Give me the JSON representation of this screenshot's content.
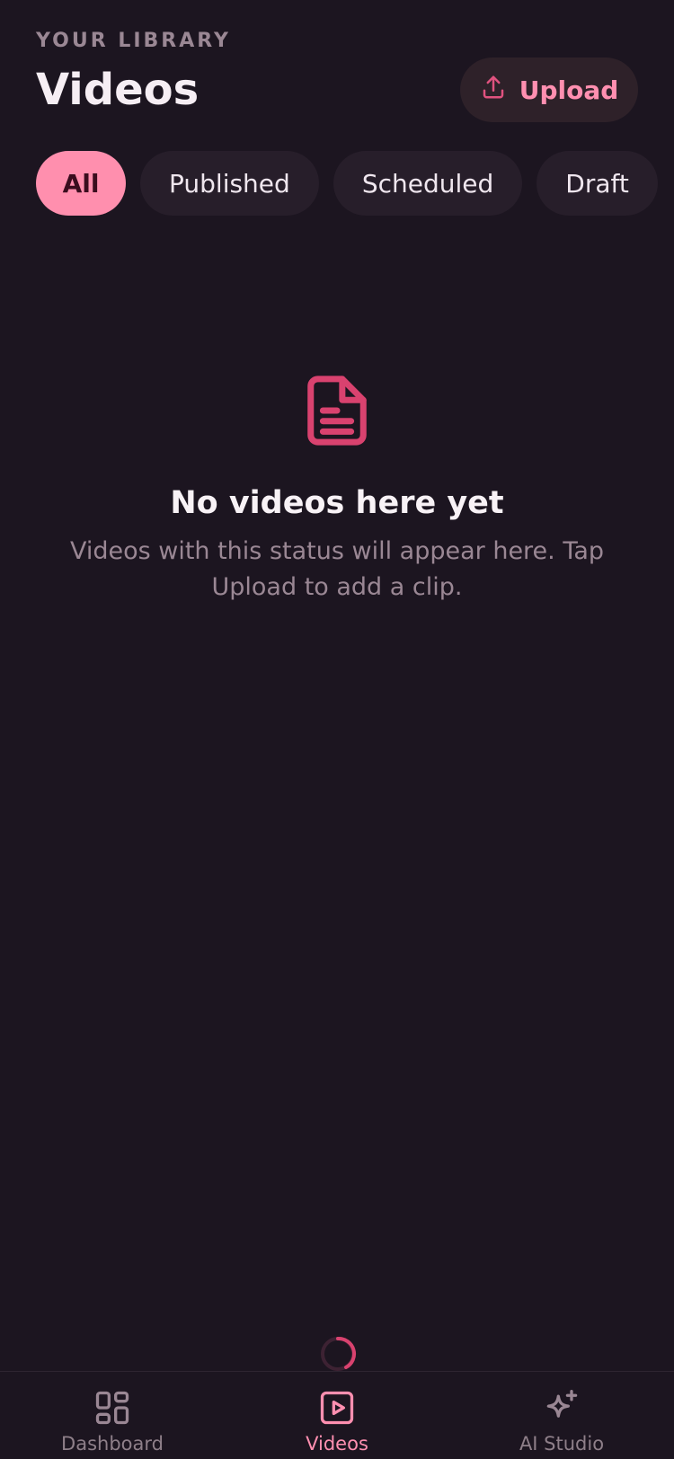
{
  "header": {
    "eyebrow": "YOUR LIBRARY",
    "title": "Videos",
    "upload_label": "Upload"
  },
  "filters": {
    "all": "All",
    "published": "Published",
    "scheduled": "Scheduled",
    "draft": "Draft",
    "selected": "All"
  },
  "empty_state": {
    "icon": "document-icon",
    "title": "No videos here yet",
    "message": "Videos with this status will appear here. Tap Upload to add a clip."
  },
  "bottom_nav": {
    "dashboard": "Dashboard",
    "videos": "Videos",
    "ai_studio": "AI Studio",
    "active": "Videos"
  },
  "colors": {
    "background": "#1c1520",
    "accent": "#ff8fae",
    "muted_text": "#9a8794"
  }
}
